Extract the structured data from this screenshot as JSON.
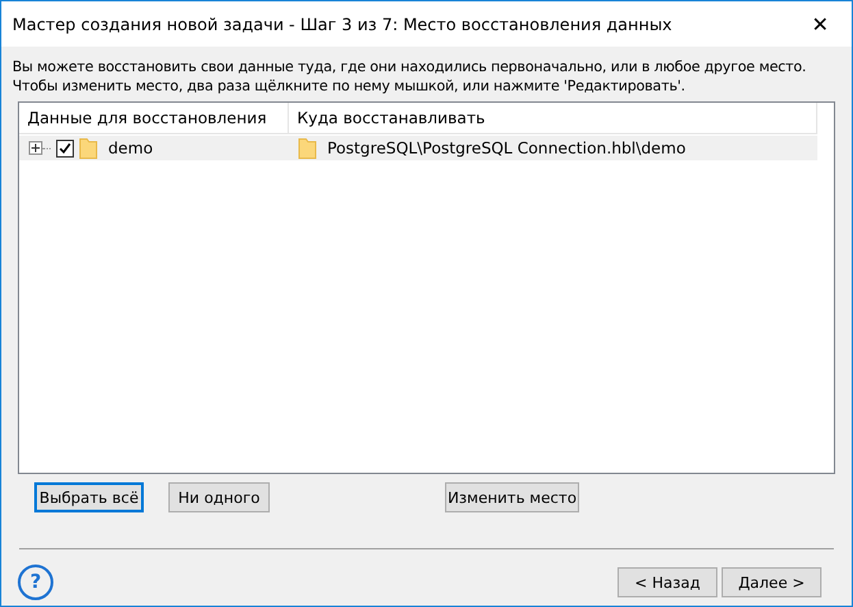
{
  "window": {
    "title": "Мастер создания новой задачи - Шаг 3 из 7: Место восстановления данных",
    "close": "✕"
  },
  "description": "Вы можете восстановить свои данные туда, где они находились первоначально, или в любое другое место. Чтобы изменить место, два раза щёлкните по нему мышкой, или нажмите 'Редактировать'.",
  "table": {
    "columns": [
      "Данные для восстановления",
      "Куда восстанавливать"
    ],
    "rows": [
      {
        "name": "demo",
        "destination": "PostgreSQL\\PostgreSQL Connection.hbl\\demo",
        "expanded": false,
        "checked": true,
        "selected": true
      }
    ]
  },
  "actions": [
    {
      "label": "Выбрать всё",
      "focused": true
    },
    {
      "label": "Ни одного",
      "focused": false
    },
    {
      "label": "Изменить место",
      "focused": false
    }
  ],
  "help": "?",
  "nav": [
    {
      "label": "< Назад"
    },
    {
      "label": "Далее >"
    }
  ]
}
